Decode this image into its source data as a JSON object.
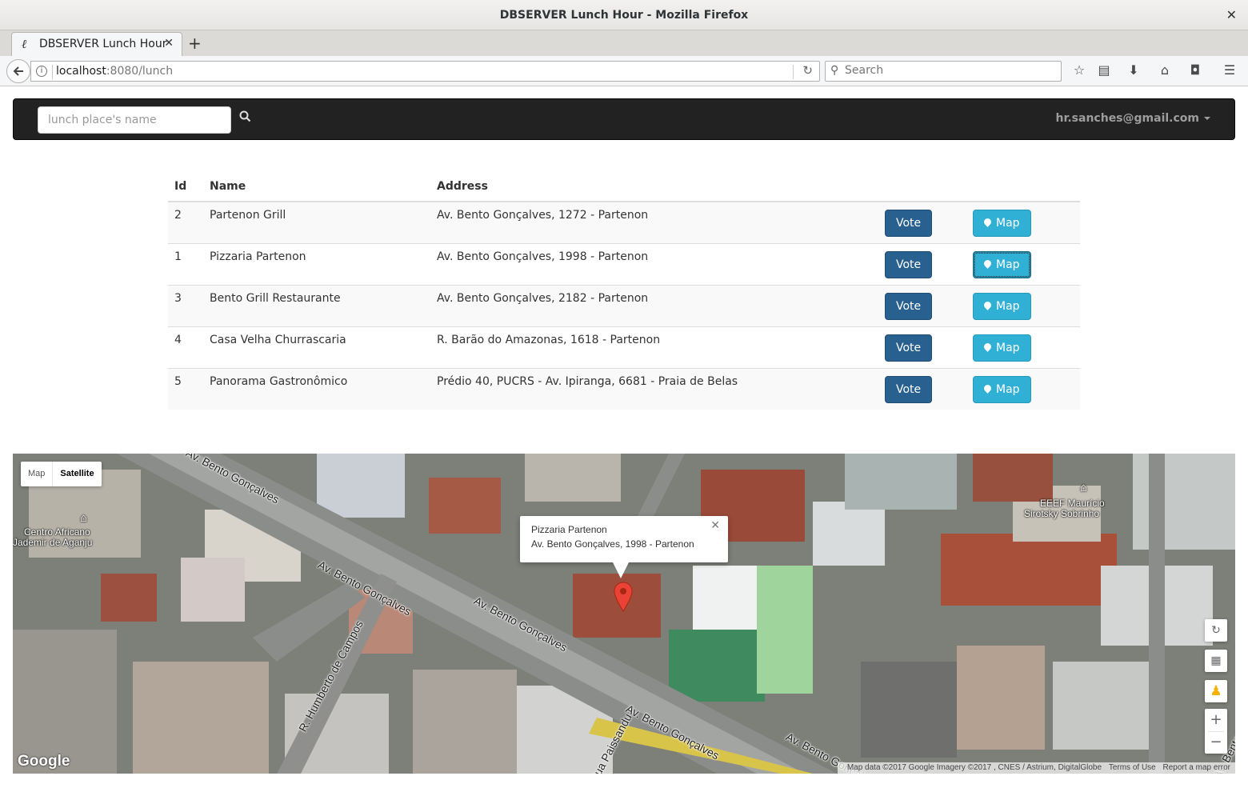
{
  "window": {
    "title": "DBSERVER Lunch Hour - Mozilla Firefox",
    "close_glyph": "✕"
  },
  "tabs": [
    {
      "label": "DBSERVER Lunch Hour",
      "favicon": "ℓ",
      "close": "✕"
    }
  ],
  "new_tab": "+",
  "toolbar": {
    "url_host": "localhost",
    "url_rest": ":8080/lunch",
    "search_placeholder": "Search",
    "icons": [
      "bookmark-star-icon",
      "reading-list-icon",
      "download-icon",
      "home-icon",
      "pocket-icon",
      "menu-icon"
    ]
  },
  "appnav": {
    "search_placeholder": "lunch place's name",
    "user": "hr.sanches@gmail.com"
  },
  "table": {
    "headers": {
      "id": "Id",
      "name": "Name",
      "address": "Address"
    },
    "vote_label": "Vote",
    "map_label": "Map",
    "rows": [
      {
        "id": "2",
        "name": "Partenon Grill",
        "address": "Av. Bento Gonçalves, 1272 - Partenon"
      },
      {
        "id": "1",
        "name": "Pizzaria Partenon",
        "address": "Av. Bento Gonçalves, 1998 - Partenon"
      },
      {
        "id": "3",
        "name": "Bento Grill Restaurante",
        "address": "Av. Bento Gonçalves, 2182 - Partenon"
      },
      {
        "id": "4",
        "name": "Casa Velha Churrascaria",
        "address": "R. Barão do Amazonas, 1618 - Partenon"
      },
      {
        "id": "5",
        "name": "Panorama Gastronômico",
        "address": "Prédio 40, PUCRS - Av. Ipiranga, 6681 - Praia de Belas"
      }
    ]
  },
  "map": {
    "type_map": "Map",
    "type_satellite": "Satellite",
    "info_title": "Pizzaria Partenon",
    "info_address": "Av. Bento Gonçalves, 1998 - Partenon",
    "poi_1": "Centro Africano",
    "poi_1b": "Jademir de Aganju",
    "poi_2": "EEEF Maurício",
    "poi_2b": "Sirotsky Sobrinho",
    "street_1": "Av. Bento Gonçalves",
    "street_2": "Av. Bento Gonçalves",
    "street_3": "Av. Bento Gonçalves",
    "street_4": "Av. Bento Gonçalves",
    "street_5": "Av. Bento Gonçalves",
    "street_6": "R. Humberto de Campos",
    "street_7": "Rua Paissandu",
    "street_8": "Av. Bento Gonçalves",
    "logo": "Google",
    "attribution": "Map data ©2017 Google Imagery ©2017 , CNES / Astrium, DigitalGlobe",
    "terms": "Terms of Use",
    "report": "Report a map error",
    "zoom_in": "+",
    "zoom_out": "−"
  }
}
